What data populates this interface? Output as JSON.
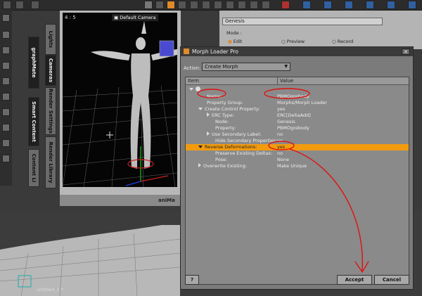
{
  "viewport": {
    "label": "4 : 5",
    "camera": "Default Camera",
    "bottom_label": "aniMa"
  },
  "side_tabs": [
    "graphMate",
    "Smart Content",
    "Content Li",
    "Lights",
    "Cameras",
    "Render Settings",
    "Render Library"
  ],
  "parameters": {
    "figure": "Genesis",
    "mode_label": "Mode :",
    "modes": [
      "Edit",
      "Preview",
      "Record"
    ]
  },
  "dialog": {
    "title": "Morph Loader Pro",
    "close": "×",
    "action_label": "Action:",
    "action_value": "Create Morph",
    "columns": [
      "Item",
      "Value"
    ],
    "rows": [
      {
        "key": "Name:",
        "value": "PBMOgrebody"
      },
      {
        "key": "Property Group:",
        "value": "Morphs/Morph Loader"
      },
      {
        "key": "Create Control Property:",
        "value": "yes"
      },
      {
        "key": "ERC Type:",
        "value": "ERC[DeltaAdd]"
      },
      {
        "key": "Node:",
        "value": "Genesis"
      },
      {
        "key": "Property:",
        "value": "PBMOgrebody"
      },
      {
        "key": "Use Secondary Label:",
        "value": "no"
      },
      {
        "key": "Hide Secondary Properties:",
        "value": "no"
      },
      {
        "key": "Reverse Deformations:",
        "value": "yes"
      },
      {
        "key": "Preserve Existing Deltas:",
        "value": "no"
      },
      {
        "key": "Pose:",
        "value": "None"
      },
      {
        "key": "Overwrite Existing:",
        "value": "Make Unique"
      }
    ],
    "help": "?",
    "accept": "Accept",
    "cancel": "Cancel"
  },
  "status": {
    "scene": "untitled_1 *"
  },
  "colors": {
    "highlight": "#f29b0e",
    "annotation": "#e01010",
    "accent": "#e08a2a"
  }
}
